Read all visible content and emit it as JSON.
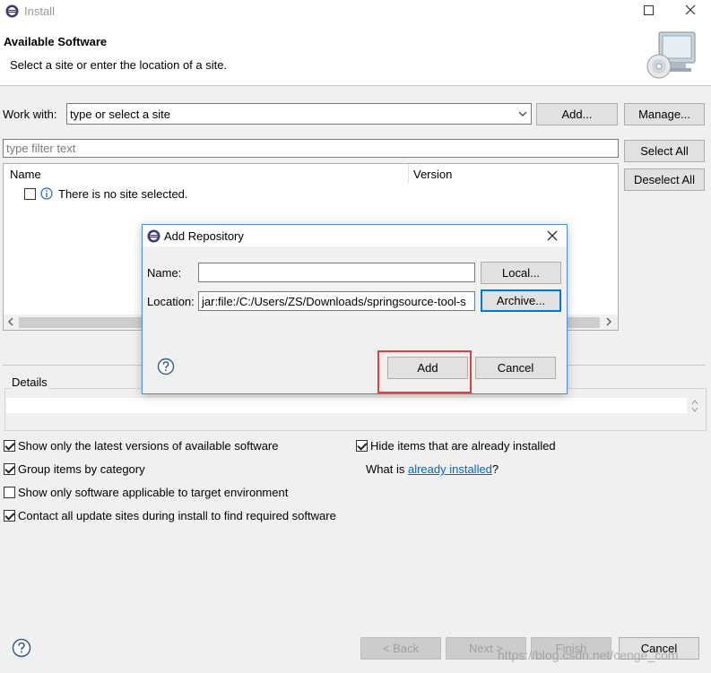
{
  "window": {
    "title": "Install"
  },
  "header": {
    "title": "Available Software",
    "subtitle": "Select a site or enter the location of a site."
  },
  "work_with": {
    "label": "Work with:",
    "placeholder": "type or select a site",
    "add_label": "Add...",
    "manage_label": "Manage..."
  },
  "filter": {
    "placeholder": "type filter text"
  },
  "side_buttons": {
    "select_all": "Select All",
    "deselect_all": "Deselect All"
  },
  "table": {
    "columns": [
      "Name",
      "Version"
    ],
    "empty_message": "There is no site selected."
  },
  "details": {
    "label": "Details"
  },
  "options": {
    "latest_versions": {
      "label": "Show only the latest versions of available software",
      "checked": true
    },
    "group_by_category": {
      "label": "Group items by category",
      "checked": true
    },
    "target_env": {
      "label": "Show only software applicable to target environment",
      "checked": false
    },
    "contact_sites": {
      "label": "Contact all update sites during install to find required software",
      "checked": true
    },
    "hide_installed": {
      "label": "Hide items that are already installed",
      "checked": true
    },
    "what_is_prefix": "What is ",
    "what_is_link": "already installed",
    "what_is_suffix": "?"
  },
  "footer": {
    "back": "< Back",
    "next": "Next >",
    "finish": "Finish",
    "cancel": "Cancel",
    "watermark": "https://blog.csdn.net/cenge_com"
  },
  "dialog": {
    "title": "Add Repository",
    "name_label": "Name:",
    "name_value": "",
    "location_label": "Location:",
    "location_value": "jar:file:/C:/Users/ZS/Downloads/springsource-tool-s",
    "local_label": "Local...",
    "archive_label": "Archive...",
    "add_label": "Add",
    "cancel_label": "Cancel"
  },
  "colors": {
    "highlight": "#e04040",
    "link": "#0066cc",
    "focus": "#0078d7"
  }
}
